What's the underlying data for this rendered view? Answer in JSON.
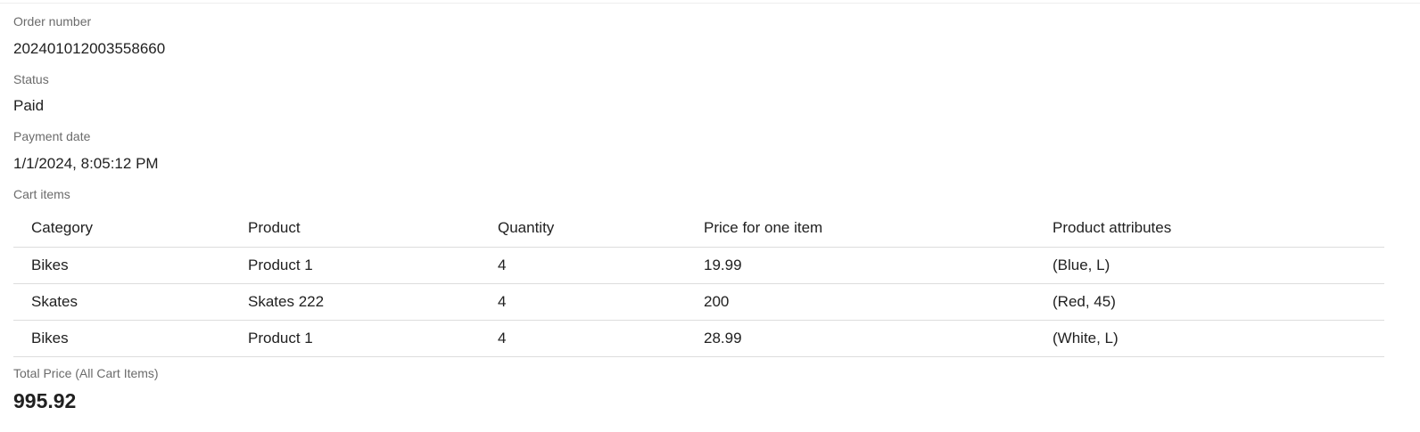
{
  "order": {
    "number_label": "Order number",
    "number_value": "202401012003558660",
    "status_label": "Status",
    "status_value": "Paid",
    "payment_date_label": "Payment date",
    "payment_date_value": "1/1/2024, 8:05:12 PM",
    "cart_items_label": "Cart items",
    "total_label": "Total Price (All Cart Items)",
    "total_value": "995.92"
  },
  "cart": {
    "headers": [
      "Category",
      "Product",
      "Quantity",
      "Price for one item",
      "Product attributes"
    ],
    "rows": [
      [
        "Bikes",
        "Product 1",
        "4",
        "19.99",
        "(Blue, L)"
      ],
      [
        "Skates",
        "Skates 222",
        "4",
        "200",
        "(Red, 45)"
      ],
      [
        "Bikes",
        "Product 1",
        "4",
        "28.99",
        "(White, L)"
      ]
    ]
  }
}
